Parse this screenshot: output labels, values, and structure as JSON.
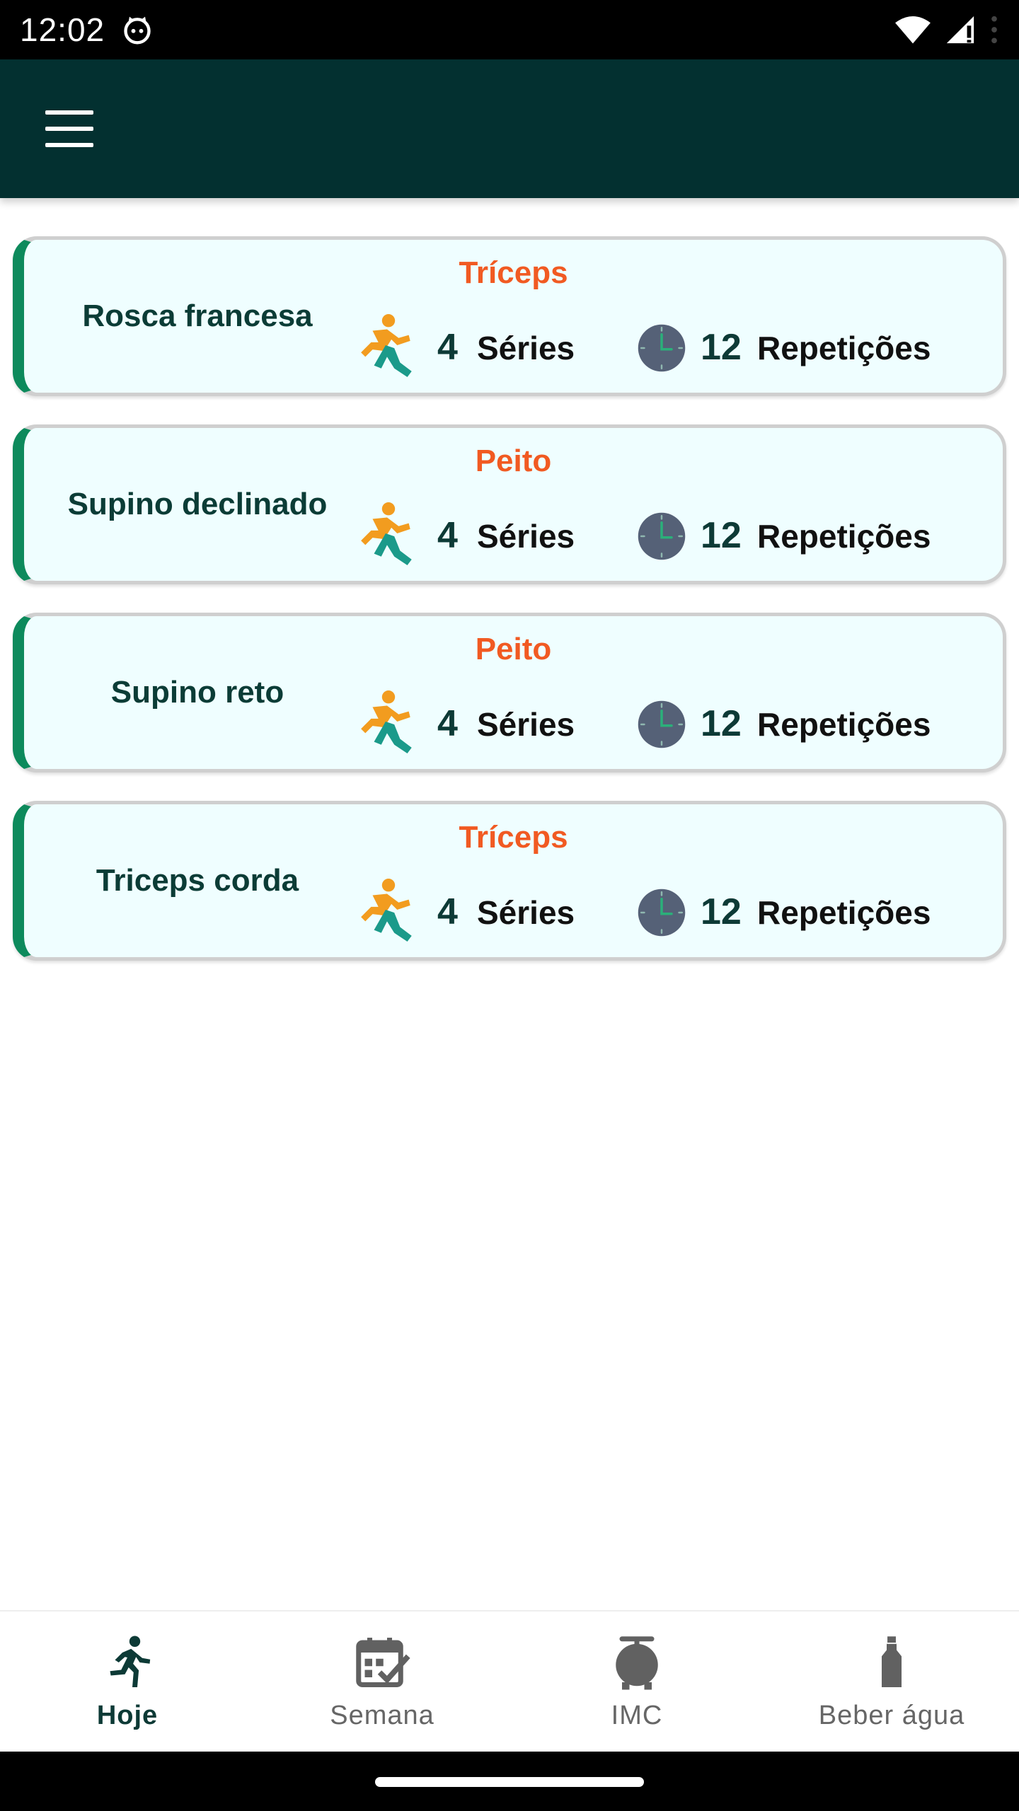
{
  "status_bar": {
    "time": "12:02"
  },
  "exercises": [
    {
      "name": "Rosca francesa",
      "muscle": "Tríceps",
      "series_count": "4",
      "series_label": "Séries",
      "reps_count": "12",
      "reps_label": "Repetições"
    },
    {
      "name": "Supino declinado",
      "muscle": "Peito",
      "series_count": "4",
      "series_label": "Séries",
      "reps_count": "12",
      "reps_label": "Repetições"
    },
    {
      "name": "Supino reto",
      "muscle": "Peito",
      "series_count": "4",
      "series_label": "Séries",
      "reps_count": "12",
      "reps_label": "Repetições"
    },
    {
      "name": "Triceps corda",
      "muscle": "Tríceps",
      "series_count": "4",
      "series_label": "Séries",
      "reps_count": "12",
      "reps_label": "Repetições"
    }
  ],
  "bottom_nav": [
    {
      "label": "Hoje",
      "icon": "runner-icon",
      "active": true
    },
    {
      "label": "Semana",
      "icon": "calendar-check-icon",
      "active": false
    },
    {
      "label": "IMC",
      "icon": "scale-icon",
      "active": false
    },
    {
      "label": "Beber água",
      "icon": "bottle-icon",
      "active": false
    }
  ],
  "colors": {
    "appbar": "#033030",
    "card_background": "#effeff",
    "card_accent": "#0d8a5c",
    "muscle_text": "#f15a22",
    "title_text": "#0b3c36"
  }
}
